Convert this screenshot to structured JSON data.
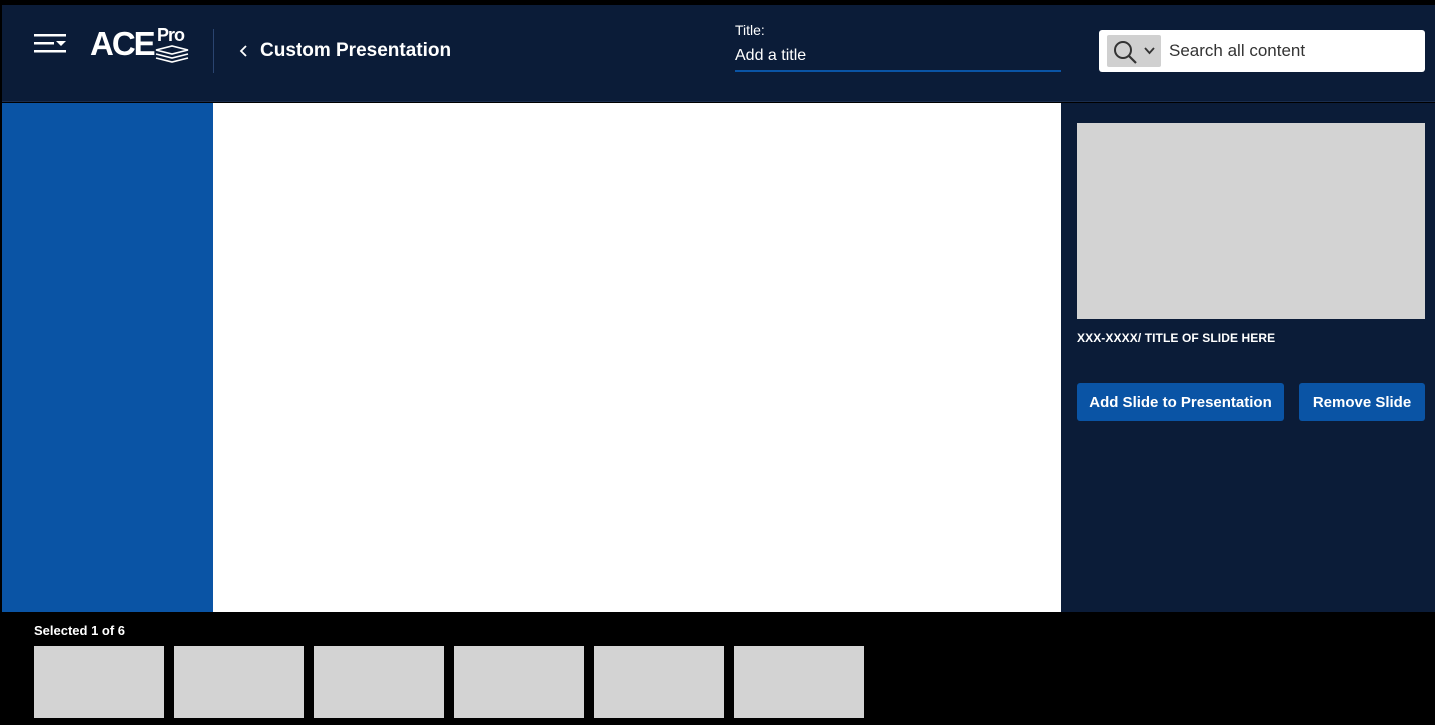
{
  "header": {
    "logo_text": "ACE",
    "logo_sup": "Pro",
    "back_label": "Custom Presentation",
    "title_label": "Title:",
    "title_placeholder": "Add a title",
    "search_placeholder": "Search all content"
  },
  "icons": {
    "menu": "menu-collapse-icon",
    "back": "chevron-left-icon",
    "search": "search-icon",
    "scope": "chevron-down-icon"
  },
  "right_panel": {
    "slide_title": "XXX-XXXX/ TITLE OF SLIDE HERE",
    "add_button": "Add Slide to Presentation",
    "remove_button": "Remove Slide"
  },
  "filmstrip": {
    "selected_label": "Selected 1 of 6",
    "thumb_count": 6
  },
  "colors": {
    "header_bg": "#0b1c38",
    "accent_blue": "#0a54a5",
    "placeholder_gray": "#d3d3d3"
  }
}
